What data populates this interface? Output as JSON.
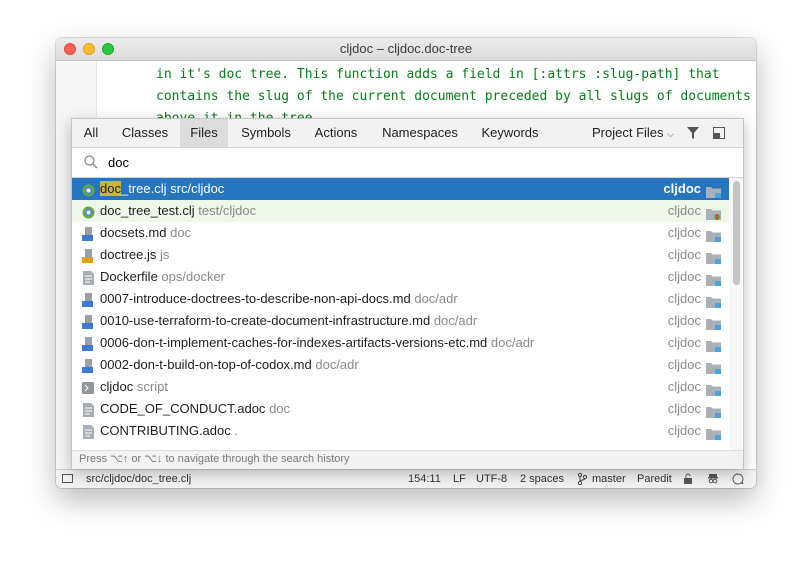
{
  "window": {
    "title": "cljdoc – cljdoc.doc-tree"
  },
  "editor": {
    "lines": [
      "in it's doc tree. This function adds a field in [:attrs :slug-path] that",
      "contains the slug of the current document preceded by all slugs of documents",
      "above it in the tree"
    ]
  },
  "popup": {
    "tabs": [
      "All",
      "Classes",
      "Files",
      "Symbols",
      "Actions",
      "Namespaces",
      "Keywords"
    ],
    "active_tab": "Files",
    "scope": "Project Files",
    "search": {
      "value": "doc"
    },
    "results": [
      {
        "name": "doc_tree.clj",
        "match": "doc",
        "rest": "_tree.clj",
        "path": "src/cljdoc",
        "project": "cljdoc",
        "icon": "clojure-file-icon",
        "selected": true
      },
      {
        "name": "doc_tree_test.clj",
        "path": "test/cljdoc",
        "project": "cljdoc",
        "icon": "clojure-file-icon",
        "test": true
      },
      {
        "name": "docsets.md",
        "path": "doc",
        "project": "cljdoc",
        "icon": "markdown-file-icon"
      },
      {
        "name": "doctree.js",
        "path": "js",
        "project": "cljdoc",
        "icon": "javascript-file-icon"
      },
      {
        "name": "Dockerfile",
        "path": "ops/docker",
        "project": "cljdoc",
        "icon": "text-file-icon"
      },
      {
        "name": "0007-introduce-doctrees-to-describe-non-api-docs.md",
        "path": "doc/adr",
        "project": "cljdoc",
        "icon": "markdown-file-icon"
      },
      {
        "name": "0010-use-terraform-to-create-document-infrastructure.md",
        "path": "doc/adr",
        "project": "cljdoc",
        "icon": "markdown-file-icon"
      },
      {
        "name": "0006-don-t-implement-caches-for-indexes-artifacts-versions-etc.md",
        "path": "doc/adr",
        "project": "cljdoc",
        "icon": "markdown-file-icon"
      },
      {
        "name": "0002-don-t-build-on-top-of-codox.md",
        "path": "doc/adr",
        "project": "cljdoc",
        "icon": "markdown-file-icon"
      },
      {
        "name": "cljdoc",
        "path": "script",
        "project": "cljdoc",
        "icon": "shell-script-icon"
      },
      {
        "name": "CODE_OF_CONDUCT.adoc",
        "path": "doc",
        "project": "cljdoc",
        "icon": "text-file-icon"
      },
      {
        "name": "CONTRIBUTING.adoc",
        "path": ".",
        "project": "cljdoc",
        "icon": "text-file-icon"
      }
    ],
    "hint": "Press ⌥↑ or ⌥↓ to navigate through the search history"
  },
  "status": {
    "file_path": "src/cljdoc/doc_tree.clj",
    "position": "154:11",
    "line_sep": "LF",
    "encoding": "UTF-8",
    "indent": "2 spaces",
    "branch": "master",
    "mode": "Paredit"
  },
  "colors": {
    "selection": "#2675bf",
    "code": "#067d17",
    "test_row": "#eef7e8"
  }
}
